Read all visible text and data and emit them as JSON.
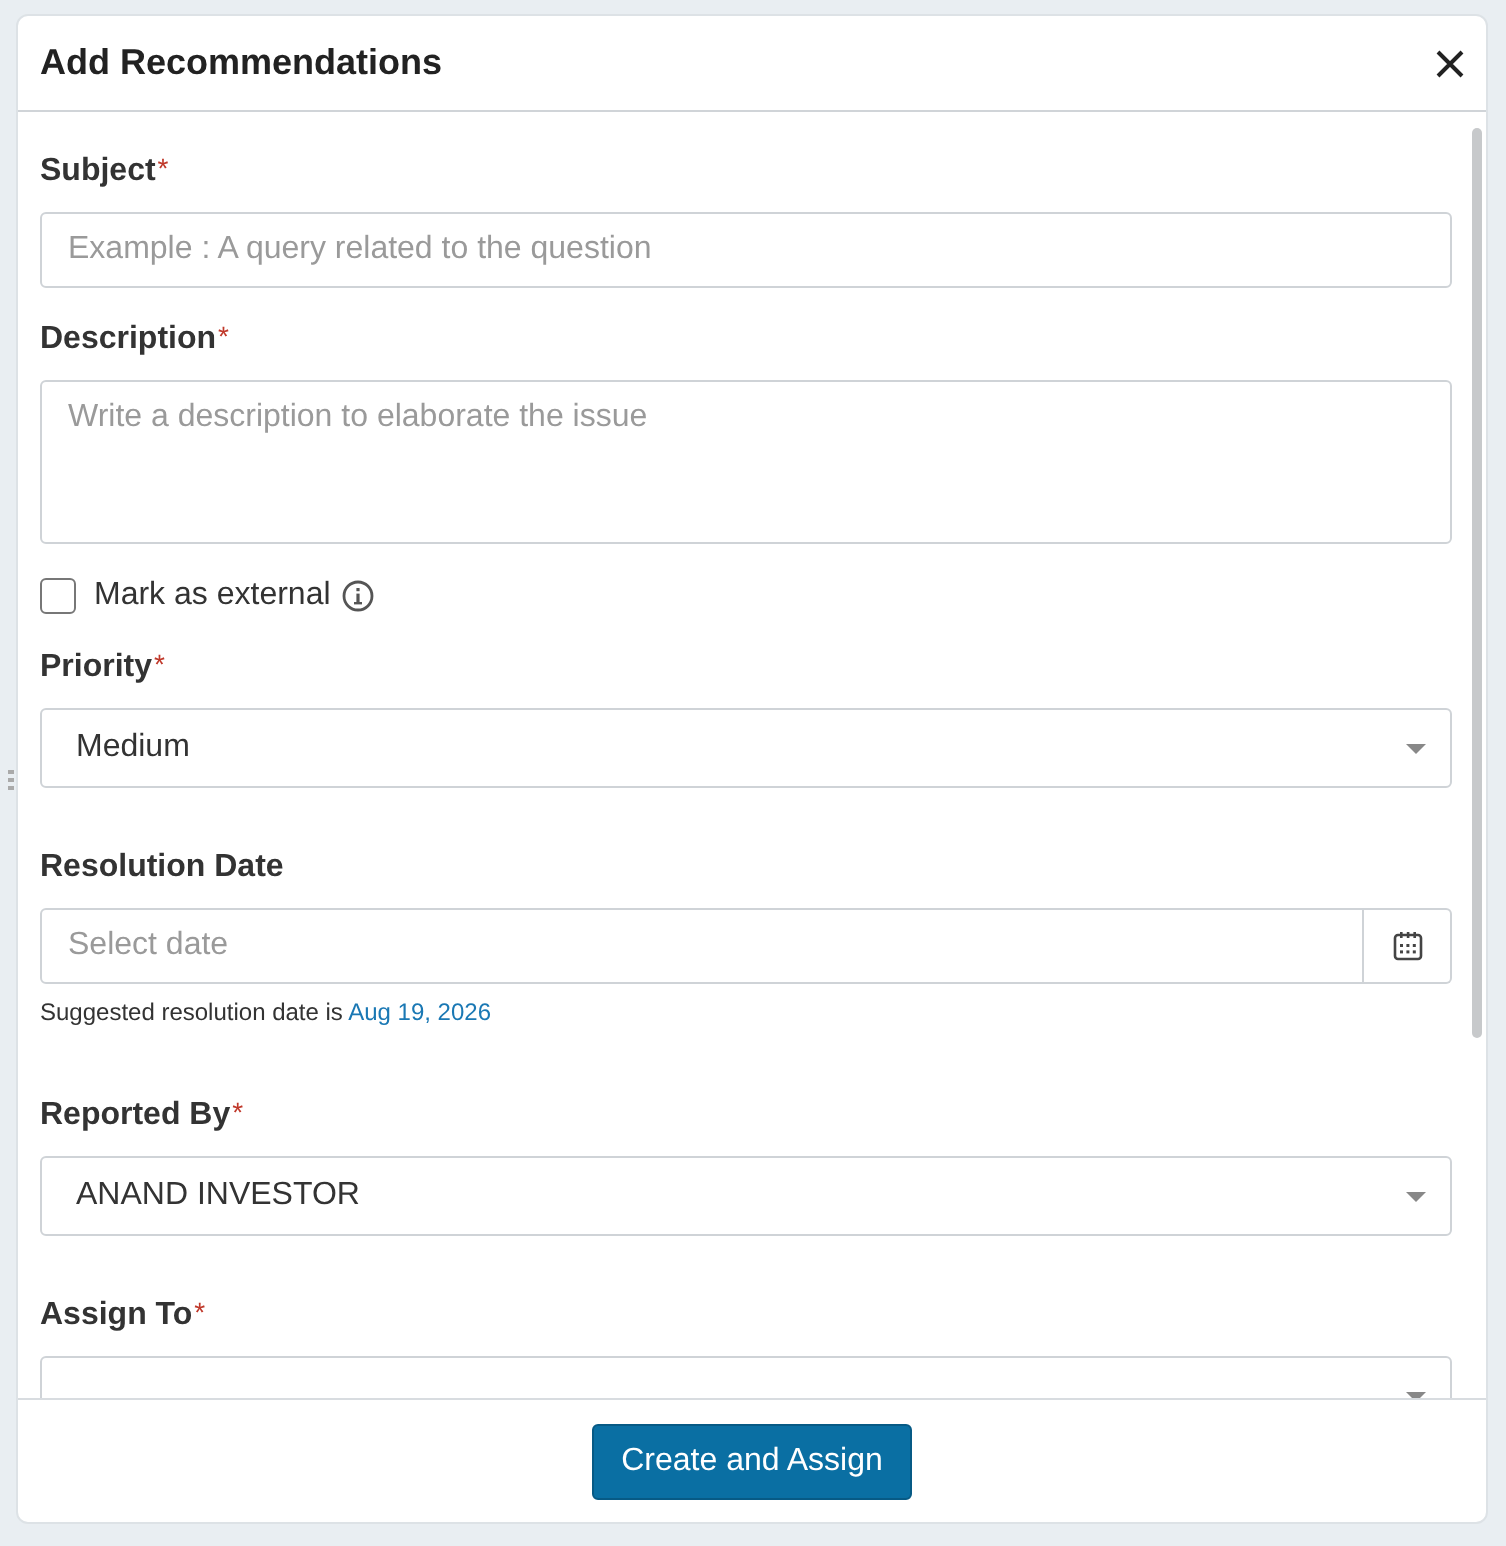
{
  "dialog": {
    "title": "Add Recommendations"
  },
  "fields": [
    {
      "kind": "text",
      "label": "Subject",
      "required_mark": "*",
      "placeholder": "Example : A query related to the question"
    },
    {
      "kind": "textarea",
      "label": "Description",
      "required_mark": "*",
      "placeholder": "Write a description to elaborate the issue"
    },
    {
      "kind": "checkbox",
      "label": "Mark as external",
      "checked": false
    },
    {
      "kind": "select",
      "label": "Priority",
      "required_mark": "*",
      "value": "Medium"
    },
    {
      "kind": "date",
      "label": "Resolution Date",
      "placeholder": "Select date",
      "hint": "Suggested resolution date is",
      "hint_link": "Aug 19, 2026"
    },
    {
      "kind": "select",
      "label": "Reported By",
      "required_mark": "*",
      "value": "ANAND INVESTOR"
    },
    {
      "kind": "select",
      "label": "Assign To",
      "required_mark": "*"
    }
  ],
  "footer": {
    "button": "Create and Assign"
  }
}
